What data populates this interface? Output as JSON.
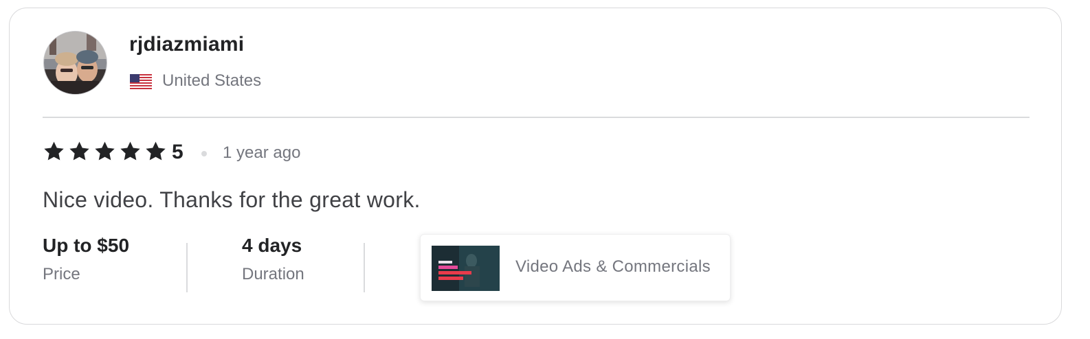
{
  "reviewer": {
    "username": "rjdiazmiami",
    "country": "United States",
    "avatar": "avatar-photo",
    "flag": "us-flag-icon"
  },
  "review": {
    "stars": 5,
    "rating_label": "5",
    "time_ago": "1 year ago",
    "text": "Nice video. Thanks for the great work."
  },
  "meta": {
    "price_value": "Up to $50",
    "price_label": "Price",
    "duration_value": "4 days",
    "duration_label": "Duration"
  },
  "gig": {
    "title": "Video Ads & Commercials",
    "thumbnail": "gig-thumbnail-image"
  },
  "colors": {
    "star": "#222325",
    "text_primary": "#222325",
    "text_secondary": "#74767e",
    "border": "#dadbdd"
  }
}
